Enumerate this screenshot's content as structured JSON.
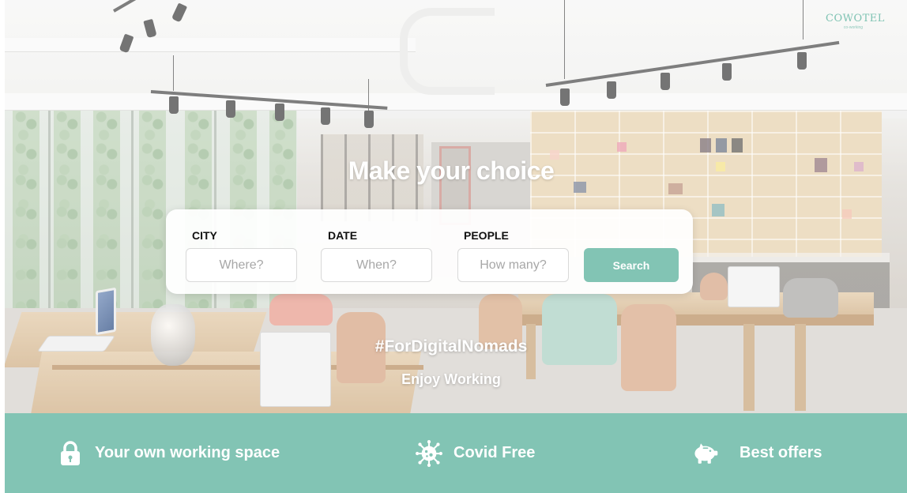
{
  "brand": {
    "name": "COWOTEL",
    "tagline": "co-working"
  },
  "hero": {
    "headline": "Make your choice",
    "hashtag": "#ForDigitalNomads",
    "subline": "Enjoy Working"
  },
  "search": {
    "city": {
      "label": "CITY",
      "placeholder": "Where?"
    },
    "date": {
      "label": "DATE",
      "placeholder": "When?"
    },
    "people": {
      "label": "PEOPLE",
      "placeholder": "How many?"
    },
    "button_label": "Search"
  },
  "features": [
    {
      "icon": "lock-icon",
      "label": "Your own working space"
    },
    {
      "icon": "virus-icon",
      "label": "Covid Free"
    },
    {
      "icon": "piggy-bank-icon",
      "label": "Best offers"
    }
  ],
  "colors": {
    "accent": "#82c4b4",
    "text_dark": "#111111",
    "white": "#ffffff"
  }
}
